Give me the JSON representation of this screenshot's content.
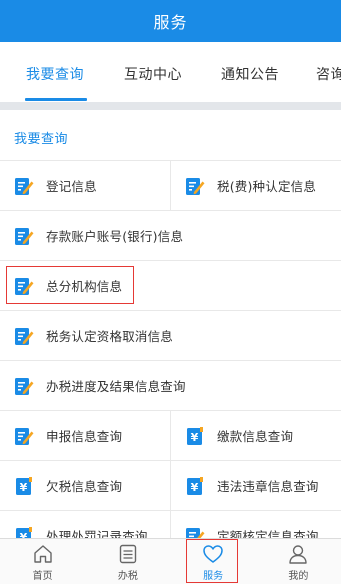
{
  "header": {
    "title": "服务"
  },
  "tabs": [
    {
      "label": "我要查询",
      "active": true
    },
    {
      "label": "互动中心",
      "active": false
    },
    {
      "label": "通知公告",
      "active": false
    },
    {
      "label": "咨询",
      "active": false
    }
  ],
  "section": {
    "title": "我要查询"
  },
  "items": {
    "r1a": {
      "label": "登记信息",
      "icon": "form-edit-icon"
    },
    "r1b": {
      "label": "税(费)种认定信息",
      "icon": "form-edit-icon"
    },
    "r2": {
      "label": "存款账户账号(银行)信息",
      "icon": "form-edit-icon"
    },
    "r3": {
      "label": "总分机构信息",
      "icon": "form-edit-icon"
    },
    "r4": {
      "label": "税务认定资格取消信息",
      "icon": "form-edit-icon"
    },
    "r5": {
      "label": "办税进度及结果信息查询",
      "icon": "form-edit-icon"
    },
    "r6a": {
      "label": "申报信息查询",
      "icon": "form-edit-icon"
    },
    "r6b": {
      "label": "缴款信息查询",
      "icon": "yuan-doc-icon"
    },
    "r7a": {
      "label": "欠税信息查询",
      "icon": "yuan-doc-icon"
    },
    "r7b": {
      "label": "违法违章信息查询",
      "icon": "yuan-doc-icon"
    },
    "r8a": {
      "label": "处理处罚记录查询",
      "icon": "yuan-doc-icon"
    },
    "r8b": {
      "label": "定额核定信息查询",
      "icon": "form-edit-icon"
    }
  },
  "bottom_nav": [
    {
      "label": "首页",
      "icon": "home-icon",
      "active": false
    },
    {
      "label": "办税",
      "icon": "list-icon",
      "active": false
    },
    {
      "label": "服务",
      "icon": "heart-icon",
      "active": true
    },
    {
      "label": "我的",
      "icon": "user-icon",
      "active": false
    }
  ],
  "colors": {
    "primary": "#1a8be6",
    "highlight": "#e53935",
    "icon_accent": "#f5a623"
  }
}
